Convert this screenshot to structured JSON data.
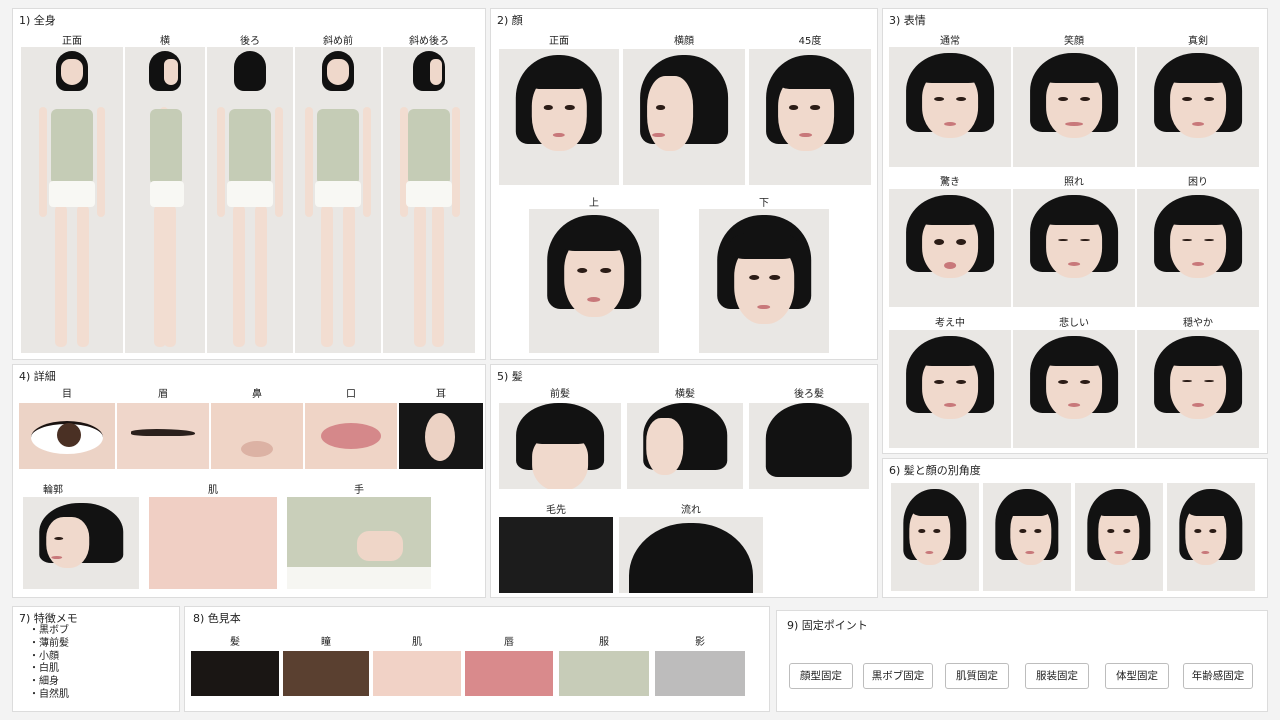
{
  "sections": {
    "full_body": {
      "title": "1) 全身",
      "views": [
        "正面",
        "横",
        "後ろ",
        "斜め前",
        "斜め後ろ"
      ]
    },
    "face": {
      "title": "2) 顔",
      "views": [
        "正面",
        "横顔",
        "45度",
        "上",
        "下"
      ]
    },
    "expression": {
      "title": "3) 表情",
      "views": [
        "通常",
        "笑顔",
        "真剣",
        "驚き",
        "照れ",
        "困り",
        "考え中",
        "悲しい",
        "穏やか"
      ]
    },
    "detail": {
      "title": "4) 詳細",
      "views": [
        "目",
        "眉",
        "鼻",
        "口",
        "耳",
        "輪郭",
        "肌",
        "手"
      ]
    },
    "hair": {
      "title": "5) 髪",
      "views": [
        "前髪",
        "横髪",
        "後ろ髪",
        "毛先",
        "流れ"
      ]
    },
    "hair_face_angles": {
      "title": "6) 髪と顔の別角度"
    },
    "feature_memo": {
      "title": "7) 特徴メモ",
      "items": [
        "・黒ボブ",
        "・薄前髪",
        "・小顔",
        "・白肌",
        "・細身",
        "・自然肌"
      ]
    },
    "color_sample": {
      "title": "8) 色見本",
      "swatches": [
        {
          "label": "髪",
          "color": "#1a1614"
        },
        {
          "label": "瞳",
          "color": "#5a4030"
        },
        {
          "label": "肌",
          "color": "#f1d2c6"
        },
        {
          "label": "唇",
          "color": "#d98a8c"
        },
        {
          "label": "服",
          "color": "#c7ccb8"
        },
        {
          "label": "影",
          "color": "#bdbcbc"
        }
      ]
    },
    "fixed_points": {
      "title": "9) 固定ポイント",
      "buttons": [
        "顔型固定",
        "黒ボブ固定",
        "肌質固定",
        "服装固定",
        "体型固定",
        "年齢感固定"
      ]
    }
  }
}
